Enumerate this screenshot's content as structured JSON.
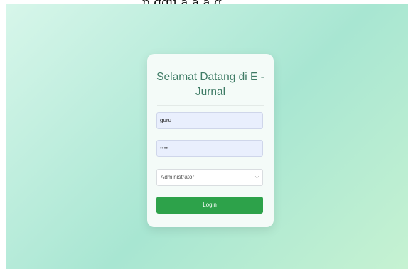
{
  "page": {
    "top_text": "p ggu a a a g"
  },
  "login": {
    "title": "Selamat Datang di E - Jurnal",
    "username_value": "guru",
    "password_value": "••••",
    "role_selected": "Administrator",
    "login_label": "Login"
  },
  "icons": {
    "select_chevron": "chevron-down-icon"
  }
}
